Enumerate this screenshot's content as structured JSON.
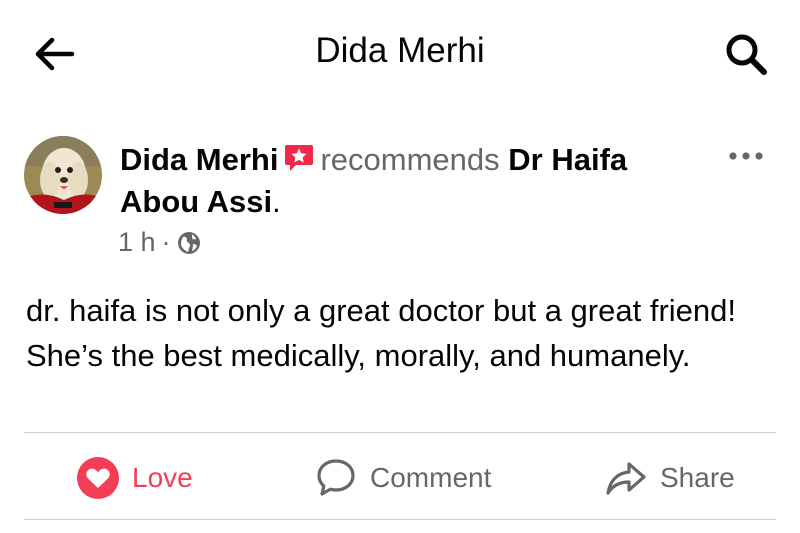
{
  "header": {
    "title": "Dida Merhi",
    "back_icon": "arrow-left-icon",
    "search_icon": "search-icon"
  },
  "post": {
    "author": "Dida Merhi",
    "verb": "recommends",
    "target": "Dr Haifa Abou Assi",
    "period": ".",
    "time": "1 h",
    "separator": "·",
    "privacy_icon": "globe-icon",
    "recommend_icon": "recommend-star-icon",
    "more_icon": "more-horizontal-icon",
    "body": "dr. haifa is not only a great doctor but a great friend! She’s the best medically, morally, and humanely."
  },
  "actions": {
    "love_label": "Love",
    "comment_label": "Comment",
    "share_label": "Share"
  },
  "colors": {
    "love": "#f33e58",
    "secondary_text": "#65676b",
    "primary_text": "#050505",
    "divider": "#ced0d4"
  }
}
